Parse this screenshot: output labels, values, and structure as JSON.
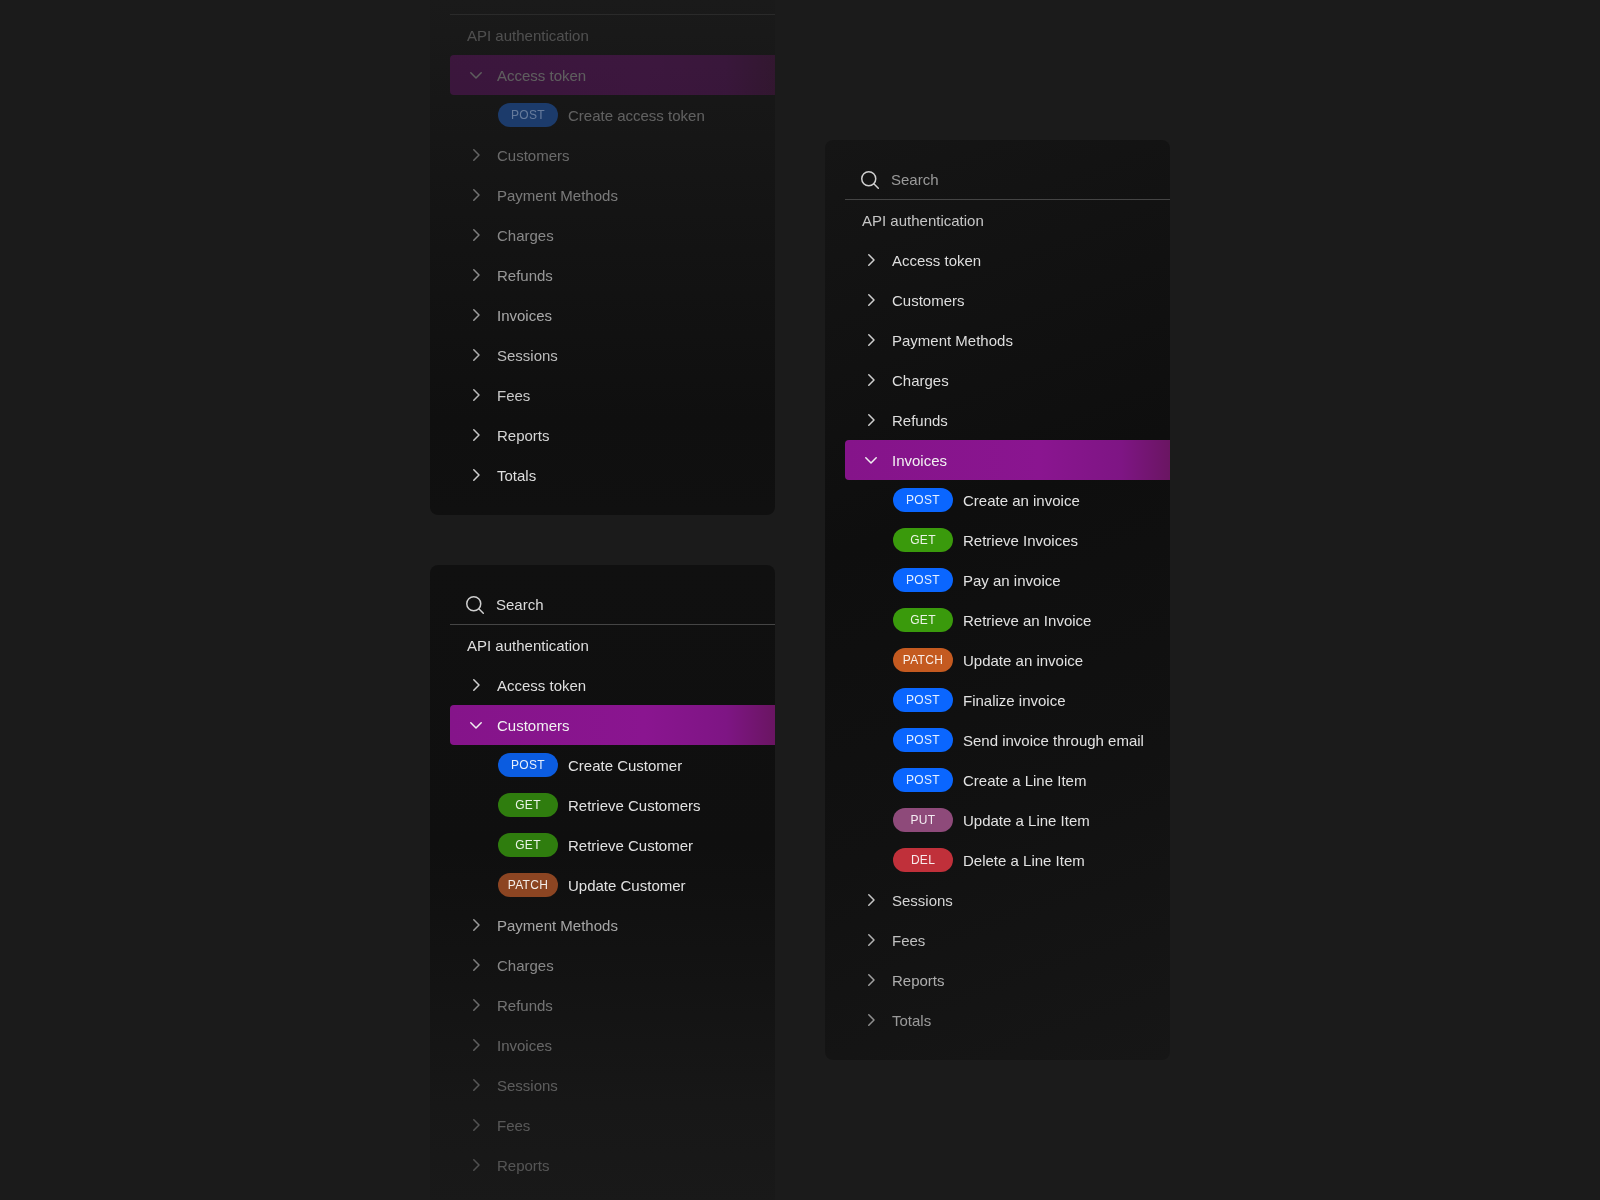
{
  "panels": [
    {
      "section": "API authentication",
      "groups": [
        {
          "label": "Access token",
          "expanded": true,
          "selected": true,
          "children": [
            {
              "method": "POST",
              "color": "#1c3b6b",
              "label": "Create access token"
            }
          ]
        },
        {
          "label": "Customers",
          "expanded": false,
          "selected": false
        },
        {
          "label": "Payment Methods",
          "expanded": false,
          "selected": false
        },
        {
          "label": "Charges",
          "expanded": false,
          "selected": false
        },
        {
          "label": "Refunds",
          "expanded": false,
          "selected": false
        },
        {
          "label": "Invoices",
          "expanded": false,
          "selected": false
        },
        {
          "label": "Sessions",
          "expanded": false,
          "selected": false
        },
        {
          "label": "Fees",
          "expanded": false,
          "selected": false
        },
        {
          "label": "Reports",
          "expanded": false,
          "selected": false
        },
        {
          "label": "Totals",
          "expanded": false,
          "selected": false
        }
      ]
    },
    {
      "search": {
        "placeholder": "Search"
      },
      "section": "API authentication",
      "groups": [
        {
          "label": "Access token",
          "expanded": false,
          "selected": false
        },
        {
          "label": "Customers",
          "expanded": true,
          "selected": true,
          "children": [
            {
              "method": "POST",
              "color": "#0b5ce0",
              "label": "Create Customer"
            },
            {
              "method": "GET",
              "color": "#2f7d0e",
              "label": "Retrieve Customers"
            },
            {
              "method": "GET",
              "color": "#2f7d0e",
              "label": "Retrieve Customer"
            },
            {
              "method": "PATCH",
              "color": "#8c4522",
              "label": "Update Customer"
            }
          ]
        },
        {
          "label": "Payment Methods",
          "expanded": false,
          "selected": false
        },
        {
          "label": "Charges",
          "expanded": false,
          "selected": false
        },
        {
          "label": "Refunds",
          "expanded": false,
          "selected": false
        },
        {
          "label": "Invoices",
          "expanded": false,
          "selected": false
        },
        {
          "label": "Sessions",
          "expanded": false,
          "selected": false
        },
        {
          "label": "Fees",
          "expanded": false,
          "selected": false
        },
        {
          "label": "Reports",
          "expanded": false,
          "selected": false
        }
      ]
    },
    {
      "search": {
        "placeholder": "Search"
      },
      "section": "API authentication",
      "groups": [
        {
          "label": "Access token",
          "expanded": false,
          "selected": false
        },
        {
          "label": "Customers",
          "expanded": false,
          "selected": false
        },
        {
          "label": "Payment Methods",
          "expanded": false,
          "selected": false
        },
        {
          "label": "Charges",
          "expanded": false,
          "selected": false
        },
        {
          "label": "Refunds",
          "expanded": false,
          "selected": false
        },
        {
          "label": "Invoices",
          "expanded": true,
          "selected": true,
          "children": [
            {
              "method": "POST",
              "color": "#0a66ff",
              "label": "Create an invoice"
            },
            {
              "method": "GET",
              "color": "#3a9a0c",
              "label": "Retrieve Invoices"
            },
            {
              "method": "POST",
              "color": "#0a66ff",
              "label": "Pay an invoice"
            },
            {
              "method": "GET",
              "color": "#3a9a0c",
              "label": "Retrieve an Invoice"
            },
            {
              "method": "PATCH",
              "color": "#c45a20",
              "label": "Update an invoice"
            },
            {
              "method": "POST",
              "color": "#0a66ff",
              "label": "Finalize invoice"
            },
            {
              "method": "POST",
              "color": "#0a66ff",
              "label": "Send invoice through email"
            },
            {
              "method": "POST",
              "color": "#0a66ff",
              "label": "Create a Line Item"
            },
            {
              "method": "PUT",
              "color": "#8e4a7a",
              "label": "Update a Line Item"
            },
            {
              "method": "DEL",
              "color": "#c0303a",
              "label": "Delete a Line Item"
            }
          ]
        },
        {
          "label": "Sessions",
          "expanded": false,
          "selected": false
        },
        {
          "label": "Fees",
          "expanded": false,
          "selected": false
        },
        {
          "label": "Reports",
          "expanded": false,
          "selected": false
        },
        {
          "label": "Totals",
          "expanded": false,
          "selected": false
        }
      ]
    }
  ]
}
